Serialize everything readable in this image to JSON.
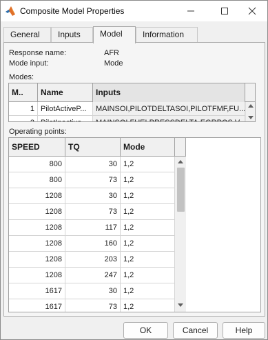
{
  "window": {
    "title": "Composite Model Properties",
    "icon": "matlab-icon"
  },
  "tabs": [
    {
      "label": "General",
      "active": false
    },
    {
      "label": "Inputs",
      "active": false
    },
    {
      "label": "Model",
      "active": true
    },
    {
      "label": "Information",
      "active": false
    }
  ],
  "model": {
    "response_label": "Response name:",
    "response_value": "AFR",
    "mode_input_label": "Mode input:",
    "mode_input_value": "Mode",
    "modes_label": "Modes:",
    "modes_table": {
      "headers": [
        "M..",
        "Name",
        "Inputs"
      ],
      "rows": [
        [
          "1",
          "PilotActiveP...",
          "MAINSOI,PILOTDELTASOI,PILOTFMF,FU..."
        ],
        [
          "2",
          "PilotInactive...",
          "MAINSOI,FUELPRESSDELTA,EGRPOS,V..."
        ]
      ]
    },
    "operating_points_label": "Operating points:",
    "op_table": {
      "headers": [
        "SPEED",
        "TQ",
        "Mode"
      ],
      "rows": [
        [
          "800",
          "30",
          "1,2"
        ],
        [
          "800",
          "73",
          "1,2"
        ],
        [
          "1208",
          "30",
          "1,2"
        ],
        [
          "1208",
          "73",
          "1,2"
        ],
        [
          "1208",
          "117",
          "1,2"
        ],
        [
          "1208",
          "160",
          "1,2"
        ],
        [
          "1208",
          "203",
          "1,2"
        ],
        [
          "1208",
          "247",
          "1,2"
        ],
        [
          "1617",
          "30",
          "1,2"
        ],
        [
          "1617",
          "73",
          "1,2"
        ]
      ]
    }
  },
  "buttons": {
    "ok": "OK",
    "cancel": "Cancel",
    "help": "Help"
  }
}
